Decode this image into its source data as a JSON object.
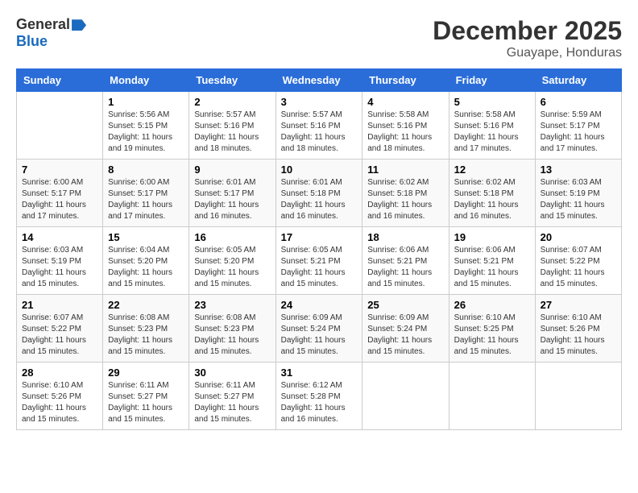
{
  "header": {
    "logo_general": "General",
    "logo_blue": "Blue",
    "month_title": "December 2025",
    "location": "Guayape, Honduras"
  },
  "weekdays": [
    "Sunday",
    "Monday",
    "Tuesday",
    "Wednesday",
    "Thursday",
    "Friday",
    "Saturday"
  ],
  "weeks": [
    [
      {
        "day": "",
        "sunrise": "",
        "sunset": "",
        "daylight": ""
      },
      {
        "day": "1",
        "sunrise": "Sunrise: 5:56 AM",
        "sunset": "Sunset: 5:15 PM",
        "daylight": "Daylight: 11 hours and 19 minutes."
      },
      {
        "day": "2",
        "sunrise": "Sunrise: 5:57 AM",
        "sunset": "Sunset: 5:16 PM",
        "daylight": "Daylight: 11 hours and 18 minutes."
      },
      {
        "day": "3",
        "sunrise": "Sunrise: 5:57 AM",
        "sunset": "Sunset: 5:16 PM",
        "daylight": "Daylight: 11 hours and 18 minutes."
      },
      {
        "day": "4",
        "sunrise": "Sunrise: 5:58 AM",
        "sunset": "Sunset: 5:16 PM",
        "daylight": "Daylight: 11 hours and 18 minutes."
      },
      {
        "day": "5",
        "sunrise": "Sunrise: 5:58 AM",
        "sunset": "Sunset: 5:16 PM",
        "daylight": "Daylight: 11 hours and 17 minutes."
      },
      {
        "day": "6",
        "sunrise": "Sunrise: 5:59 AM",
        "sunset": "Sunset: 5:17 PM",
        "daylight": "Daylight: 11 hours and 17 minutes."
      }
    ],
    [
      {
        "day": "7",
        "sunrise": "Sunrise: 6:00 AM",
        "sunset": "Sunset: 5:17 PM",
        "daylight": "Daylight: 11 hours and 17 minutes."
      },
      {
        "day": "8",
        "sunrise": "Sunrise: 6:00 AM",
        "sunset": "Sunset: 5:17 PM",
        "daylight": "Daylight: 11 hours and 17 minutes."
      },
      {
        "day": "9",
        "sunrise": "Sunrise: 6:01 AM",
        "sunset": "Sunset: 5:17 PM",
        "daylight": "Daylight: 11 hours and 16 minutes."
      },
      {
        "day": "10",
        "sunrise": "Sunrise: 6:01 AM",
        "sunset": "Sunset: 5:18 PM",
        "daylight": "Daylight: 11 hours and 16 minutes."
      },
      {
        "day": "11",
        "sunrise": "Sunrise: 6:02 AM",
        "sunset": "Sunset: 5:18 PM",
        "daylight": "Daylight: 11 hours and 16 minutes."
      },
      {
        "day": "12",
        "sunrise": "Sunrise: 6:02 AM",
        "sunset": "Sunset: 5:18 PM",
        "daylight": "Daylight: 11 hours and 16 minutes."
      },
      {
        "day": "13",
        "sunrise": "Sunrise: 6:03 AM",
        "sunset": "Sunset: 5:19 PM",
        "daylight": "Daylight: 11 hours and 15 minutes."
      }
    ],
    [
      {
        "day": "14",
        "sunrise": "Sunrise: 6:03 AM",
        "sunset": "Sunset: 5:19 PM",
        "daylight": "Daylight: 11 hours and 15 minutes."
      },
      {
        "day": "15",
        "sunrise": "Sunrise: 6:04 AM",
        "sunset": "Sunset: 5:20 PM",
        "daylight": "Daylight: 11 hours and 15 minutes."
      },
      {
        "day": "16",
        "sunrise": "Sunrise: 6:05 AM",
        "sunset": "Sunset: 5:20 PM",
        "daylight": "Daylight: 11 hours and 15 minutes."
      },
      {
        "day": "17",
        "sunrise": "Sunrise: 6:05 AM",
        "sunset": "Sunset: 5:21 PM",
        "daylight": "Daylight: 11 hours and 15 minutes."
      },
      {
        "day": "18",
        "sunrise": "Sunrise: 6:06 AM",
        "sunset": "Sunset: 5:21 PM",
        "daylight": "Daylight: 11 hours and 15 minutes."
      },
      {
        "day": "19",
        "sunrise": "Sunrise: 6:06 AM",
        "sunset": "Sunset: 5:21 PM",
        "daylight": "Daylight: 11 hours and 15 minutes."
      },
      {
        "day": "20",
        "sunrise": "Sunrise: 6:07 AM",
        "sunset": "Sunset: 5:22 PM",
        "daylight": "Daylight: 11 hours and 15 minutes."
      }
    ],
    [
      {
        "day": "21",
        "sunrise": "Sunrise: 6:07 AM",
        "sunset": "Sunset: 5:22 PM",
        "daylight": "Daylight: 11 hours and 15 minutes."
      },
      {
        "day": "22",
        "sunrise": "Sunrise: 6:08 AM",
        "sunset": "Sunset: 5:23 PM",
        "daylight": "Daylight: 11 hours and 15 minutes."
      },
      {
        "day": "23",
        "sunrise": "Sunrise: 6:08 AM",
        "sunset": "Sunset: 5:23 PM",
        "daylight": "Daylight: 11 hours and 15 minutes."
      },
      {
        "day": "24",
        "sunrise": "Sunrise: 6:09 AM",
        "sunset": "Sunset: 5:24 PM",
        "daylight": "Daylight: 11 hours and 15 minutes."
      },
      {
        "day": "25",
        "sunrise": "Sunrise: 6:09 AM",
        "sunset": "Sunset: 5:24 PM",
        "daylight": "Daylight: 11 hours and 15 minutes."
      },
      {
        "day": "26",
        "sunrise": "Sunrise: 6:10 AM",
        "sunset": "Sunset: 5:25 PM",
        "daylight": "Daylight: 11 hours and 15 minutes."
      },
      {
        "day": "27",
        "sunrise": "Sunrise: 6:10 AM",
        "sunset": "Sunset: 5:26 PM",
        "daylight": "Daylight: 11 hours and 15 minutes."
      }
    ],
    [
      {
        "day": "28",
        "sunrise": "Sunrise: 6:10 AM",
        "sunset": "Sunset: 5:26 PM",
        "daylight": "Daylight: 11 hours and 15 minutes."
      },
      {
        "day": "29",
        "sunrise": "Sunrise: 6:11 AM",
        "sunset": "Sunset: 5:27 PM",
        "daylight": "Daylight: 11 hours and 15 minutes."
      },
      {
        "day": "30",
        "sunrise": "Sunrise: 6:11 AM",
        "sunset": "Sunset: 5:27 PM",
        "daylight": "Daylight: 11 hours and 15 minutes."
      },
      {
        "day": "31",
        "sunrise": "Sunrise: 6:12 AM",
        "sunset": "Sunset: 5:28 PM",
        "daylight": "Daylight: 11 hours and 16 minutes."
      },
      {
        "day": "",
        "sunrise": "",
        "sunset": "",
        "daylight": ""
      },
      {
        "day": "",
        "sunrise": "",
        "sunset": "",
        "daylight": ""
      },
      {
        "day": "",
        "sunrise": "",
        "sunset": "",
        "daylight": ""
      }
    ]
  ]
}
